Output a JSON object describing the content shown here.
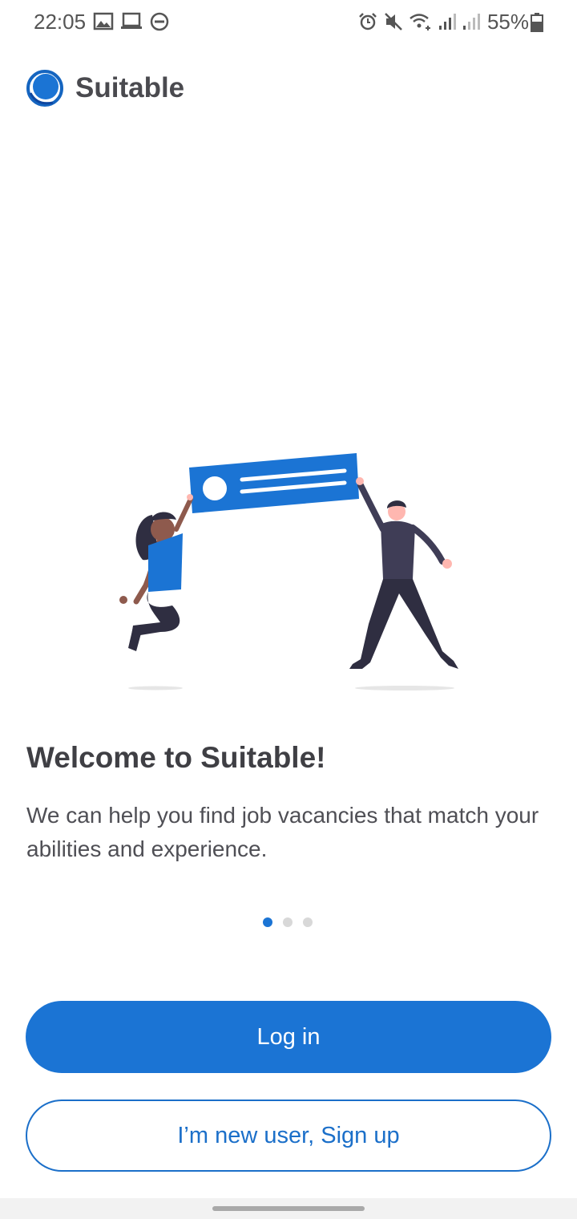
{
  "status_bar": {
    "time": "22:05",
    "battery": "55%",
    "left_icons": [
      "image-icon",
      "laptop-icon",
      "do-not-disturb-icon"
    ],
    "right_icons": [
      "alarm-icon",
      "mute-icon",
      "wifi-icon",
      "signal-icon",
      "signal-icon"
    ]
  },
  "header": {
    "app_name": "Suitable"
  },
  "onboarding": {
    "title": "Welcome to Suitable!",
    "body": "We can help you find job vacancies that match your abilities and experience.",
    "page_count": 3,
    "current_page": 1
  },
  "actions": {
    "login_label": "Log in",
    "signup_label": "I’m new user, Sign up"
  },
  "colors": {
    "primary": "#1b74d4",
    "text_dark": "#3f3f44",
    "text_body": "#4f4f55"
  }
}
